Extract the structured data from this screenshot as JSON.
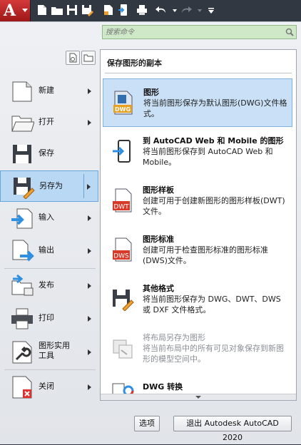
{
  "app": {
    "logo_letter": "A"
  },
  "search": {
    "placeholder": "搜索命令"
  },
  "left_menu": [
    {
      "label": "新建",
      "has_arrow": true
    },
    {
      "label": "打开",
      "has_arrow": true
    },
    {
      "label": "保存",
      "has_arrow": false
    },
    {
      "label": "另存为",
      "has_arrow": true,
      "active": true
    },
    {
      "label": "输入",
      "has_arrow": true
    },
    {
      "label": "输出",
      "has_arrow": true
    },
    {
      "label": "发布",
      "has_arrow": true
    },
    {
      "label": "打印",
      "has_arrow": true
    },
    {
      "label_line1": "图形实用",
      "label_line2": "工具",
      "has_arrow": true
    },
    {
      "label": "关闭",
      "has_arrow": true
    }
  ],
  "submenu": {
    "title": "保存图形的副本",
    "items": [
      {
        "title": "图形",
        "desc": "将当前图形保存为默认图形(DWG)文件格式。",
        "icon": "dwg-file-icon",
        "active": true
      },
      {
        "title": "到 AutoCAD Web 和 Mobile 的图形",
        "desc": "将当前图形保存到 AutoCAD Web 和 Mobile。",
        "icon": "mobile-save-icon"
      },
      {
        "title": "图形样板",
        "desc": "创建可用于创建新图形的图形样板(DWT)文件。",
        "icon": "dwt-file-icon",
        "badge": "DWT"
      },
      {
        "title": "图形标准",
        "desc": "创建可用于检查图形标准的图形标准(DWS)文件。",
        "icon": "dws-file-icon",
        "badge": "DWS"
      },
      {
        "title": "其他格式",
        "desc": "将当前图形保存为 DWG、DWT、DWS 或 DXF 文件格式。",
        "icon": "save-as-other-icon"
      },
      {
        "title": "将布局另存为图形",
        "desc": "将当前布局中的所有可见对象保存到新图形的模型空间中。",
        "icon": "layout-save-icon",
        "disabled": true
      },
      {
        "title": "DWG 转换",
        "desc": "",
        "icon": "dwg-convert-icon"
      }
    ]
  },
  "buttons": {
    "options": "选项",
    "exit": "退出 Autodesk AutoCAD 2020"
  },
  "colors": {
    "accent_red": "#c62828",
    "active_blue": "#b9d8f4",
    "search_green": "#cfe9c8"
  }
}
